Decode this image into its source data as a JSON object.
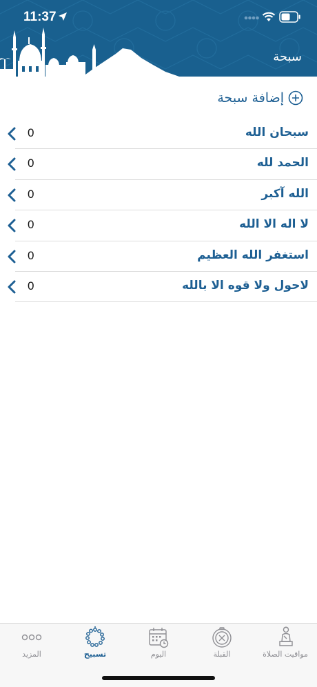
{
  "status_bar": {
    "time": "11:37"
  },
  "header": {
    "title": "سبحة"
  },
  "add_button": {
    "label": "إضافة سبحة"
  },
  "tasbih_items": [
    {
      "label": "سبحان الله",
      "count": "0"
    },
    {
      "label": "الحمد لله",
      "count": "0"
    },
    {
      "label": "الله آكبر",
      "count": "0"
    },
    {
      "label": "لا اله الا الله",
      "count": "0"
    },
    {
      "label": "استغفر الله العظيم",
      "count": "0"
    },
    {
      "label": "لاحول ولا قوه الا بالله",
      "count": "0"
    }
  ],
  "tabbar": {
    "tabs": [
      {
        "label": "المزيد",
        "icon": "more-icon",
        "active": false
      },
      {
        "label": "تسبيح",
        "icon": "prayer-beads-icon",
        "active": true
      },
      {
        "label": "اليوم",
        "icon": "calendar-icon",
        "active": false
      },
      {
        "label": "القبلة",
        "icon": "compass-icon",
        "active": false
      },
      {
        "label": "مواقيت الصلاة",
        "icon": "praying-person-icon",
        "active": false
      }
    ]
  },
  "colors": {
    "header_bg": "#19608f",
    "accent": "#1d5f93",
    "tab_inactive": "#8e8e93",
    "tabbar_bg": "#f7f7f7"
  }
}
